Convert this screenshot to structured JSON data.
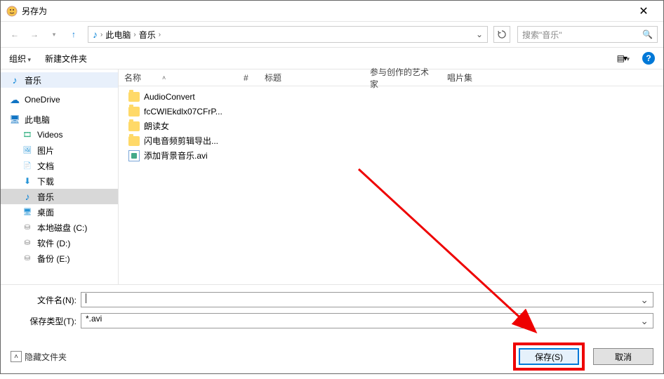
{
  "window": {
    "title": "另存为"
  },
  "nav": {
    "crumb1": "此电脑",
    "crumb2": "音乐",
    "search_placeholder": "搜索\"音乐\""
  },
  "toolbar": {
    "organize": "组织",
    "new_folder": "新建文件夹"
  },
  "sidebar": {
    "music": "音乐",
    "onedrive": "OneDrive",
    "this_pc": "此电脑",
    "videos": "Videos",
    "pictures": "图片",
    "documents": "文档",
    "downloads": "下载",
    "music2": "音乐",
    "desktop": "桌面",
    "disk_c": "本地磁盘 (C:)",
    "disk_d": "软件 (D:)",
    "disk_e": "备份 (E:)"
  },
  "columns": {
    "name": "名称",
    "num": "#",
    "title": "标题",
    "artist": "参与创作的艺术家",
    "album": "唱片集"
  },
  "files": [
    {
      "name": "AudioConvert",
      "type": "folder"
    },
    {
      "name": "fcCWIEkdlx07CFrP...",
      "type": "folder"
    },
    {
      "name": "朗读女",
      "type": "folder"
    },
    {
      "name": "闪电音频剪辑导出...",
      "type": "folder"
    },
    {
      "name": "添加背景音乐.avi",
      "type": "avi"
    }
  ],
  "bottom": {
    "filename_label": "文件名(N):",
    "filename_value": "",
    "type_label": "保存类型(T):",
    "type_value": "*.avi"
  },
  "footer": {
    "hide": "隐藏文件夹",
    "save": "保存(S)",
    "cancel": "取消"
  }
}
